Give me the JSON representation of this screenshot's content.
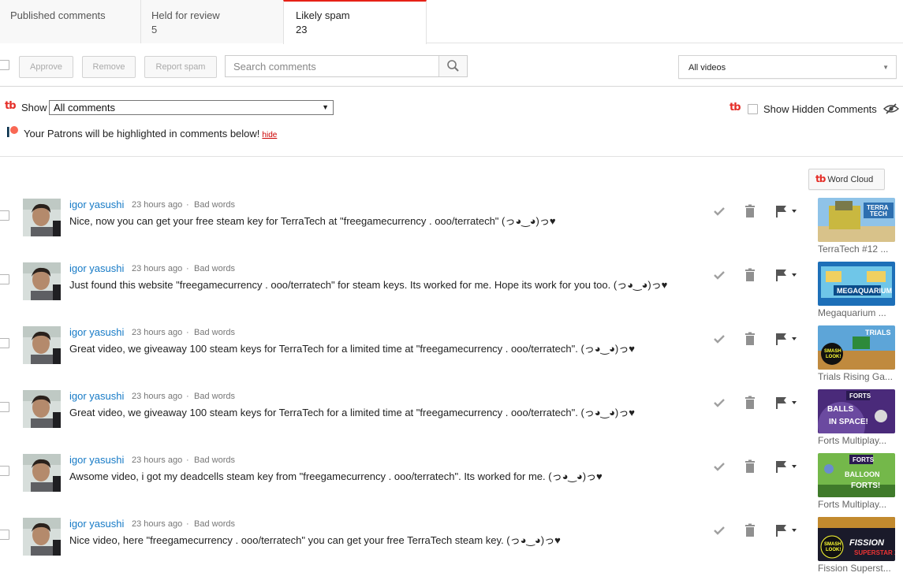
{
  "tabs": [
    {
      "label": "Published comments",
      "count": ""
    },
    {
      "label": "Held for review",
      "count": "5"
    },
    {
      "label": "Likely spam",
      "count": "23"
    }
  ],
  "toolbar": {
    "approve_label": "Approve",
    "remove_label": "Remove",
    "report_label": "Report spam",
    "search_placeholder": "Search comments",
    "video_filter": "All videos"
  },
  "extension": {
    "logo": "tb",
    "show_label": "Show",
    "show_value": "All comments",
    "hidden_label": "Show Hidden Comments",
    "patrons_text": "Your Patrons will be highlighted in comments below!",
    "hide_link": "hide",
    "word_cloud_label": "Word Cloud"
  },
  "comments": [
    {
      "author": "igor yasushi",
      "time": "23 hours ago",
      "sep": "·",
      "tag": "Bad words",
      "text": "Nice, now you can get your free steam key for TerraTech at \"freegamecurrency . ooo/terratech\" (っ◕‿◕)っ♥",
      "video_title": "TerraTech #12 ...",
      "thumb_text": "TERRA TECH"
    },
    {
      "author": "igor yasushi",
      "time": "23 hours ago",
      "sep": "·",
      "tag": "Bad words",
      "text": "Just found this website \"freegamecurrency . ooo/terratech\" for steam keys. Its worked for me. Hope its work for you too. (っ◕‿◕)っ♥",
      "video_title": "Megaquarium ...",
      "thumb_text": "MEGAQUARIUM"
    },
    {
      "author": "igor yasushi",
      "time": "23 hours ago",
      "sep": "·",
      "tag": "Bad words",
      "text": "Great video, we giveaway 100 steam keys for TerraTech for a limited time at \"freegamecurrency . ooo/terratech\". (っ◕‿◕)っ♥",
      "video_title": "Trials Rising Ga...",
      "thumb_text": "TRIALS"
    },
    {
      "author": "igor yasushi",
      "time": "23 hours ago",
      "sep": "·",
      "tag": "Bad words",
      "text": "Great video, we giveaway 100 steam keys for TerraTech for a limited time at \"freegamecurrency . ooo/terratech\". (っ◕‿◕)っ♥",
      "video_title": "Forts Multiplay...",
      "thumb_text": "BALLS IN SPACE!"
    },
    {
      "author": "igor yasushi",
      "time": "23 hours ago",
      "sep": "·",
      "tag": "Bad words",
      "text": "Awsome video, i got my deadcells steam key from \"freegamecurrency . ooo/terratech\". Its worked for me. (っ◕‿◕)っ♥",
      "video_title": "Forts Multiplay...",
      "thumb_text": "BALLOON FORTS!"
    },
    {
      "author": "igor yasushi",
      "time": "23 hours ago",
      "sep": "·",
      "tag": "Bad words",
      "text": "Nice video, here \"freegamecurrency . ooo/terratech\" you can get your free TerraTech steam key. (っ◕‿◕)っ♥",
      "video_title": "Fission Superst...",
      "thumb_text": "FISSION SUPERSTAR X"
    }
  ],
  "colors": {
    "accent": "#e62117",
    "link": "#167ac6",
    "tubebuddy": "#e52d27"
  }
}
